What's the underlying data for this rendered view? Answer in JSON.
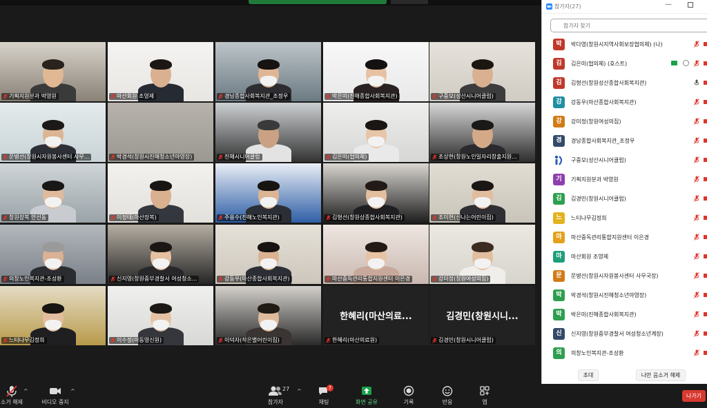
{
  "colors": {
    "accent_green": "#1aa14c",
    "mic_off_red": "#e0352b",
    "active_speaker_border": "#d8c640",
    "leave_red": "#d83a2f"
  },
  "tiles": [
    {
      "name": "기획지원분과 박영원",
      "bg": "#8a8277",
      "wall": "#d7d2ca",
      "skin": "#e0b894",
      "hair": "#2a221c",
      "shirt": "#3a3a3a",
      "mask": false
    },
    {
      "name": "마산회원 조영제",
      "bg": "#e8e6e3",
      "wall": "#f4f3f1",
      "skin": "#d9b090",
      "hair": "#1c1714",
      "shirt": "#262a33",
      "mask": false
    },
    {
      "name": "경남종합사회복지관_조정우",
      "bg": "#6c7a82",
      "wall": "#bdc5c9",
      "skin": "#dfb695",
      "hair": "#161310",
      "shirt": "#2d2d31",
      "mask": true
    },
    {
      "name": "박은미(진해종합사회복지관)",
      "bg": "#e9e9ea",
      "wall": "#f8f8f8",
      "skin": "#e6c1a3",
      "hair": "#141111",
      "shirt": "#2a2222",
      "mask": true
    },
    {
      "name": "구중모(성산시니어클럽)",
      "bg": "#d0ccc4",
      "wall": "#e6e2db",
      "skin": "#d9b090",
      "hair": "#1c1612",
      "shirt": "#3d3c3c",
      "mask": false
    },
    {
      "name": "문병선(창원시자원봉사센터 사무...",
      "bg": "#c8d3d6",
      "wall": "#e5ebec",
      "skin": "#dcb594",
      "hair": "#1c1a18",
      "shirt": "#2c2f36",
      "mask": true
    },
    {
      "name": "박경석(창원시진해청소년야영장)",
      "bg": "#9b9892",
      "wall": "#b7b3ac",
      "skin": "#000000",
      "hair": "#000000",
      "shirt": "#000000",
      "mask": false,
      "empty": true
    },
    {
      "name": "진해시니어클럽",
      "bg": "#333333",
      "wall": "#cdd0d2",
      "skin": "#caa283",
      "hair": "#3a3a3a",
      "shirt": "#e3e3e3",
      "mask": false
    },
    {
      "name": "김은미(협의체)",
      "bg": "#d6d6d4",
      "wall": "#eeeeec",
      "skin": "#e7c5a8",
      "hair": "#1a1614",
      "shirt": "#e9e9e9",
      "mask": true
    },
    {
      "name": "조상현(창원노인일자리창출지원...",
      "bg": "#2e2e2e",
      "wall": "#d7d7d7",
      "skin": "#d4a987",
      "hair": "#1b1917",
      "shirt": "#2a2a2e",
      "mask": false
    },
    {
      "name": "창원장복 안선동",
      "bg": "#9aa3a8",
      "wall": "#cfd5d8",
      "skin": "#e0bb9b",
      "hair": "#1a1816",
      "shirt": "#c8ccd0",
      "mask": true
    },
    {
      "name": "이정태(마산장복)",
      "bg": "#e3e1dc",
      "wall": "#f2f1ee",
      "skin": "#d9b090",
      "hair": "#191512",
      "shirt": "#34373e",
      "mask": false
    },
    {
      "name": "주용수(진해노인복지관)",
      "bg": "#2f5fa6",
      "wall": "#e9eef5",
      "skin": "#dcb594",
      "hair": "#171412",
      "shirt": "#2b2e35",
      "mask": true
    },
    {
      "name": "김형선(창원상종합사회복지관)",
      "bg": "#1e1e1e",
      "wall": "#d9d6d1",
      "skin": "#e3bf9f",
      "hair": "#221a16",
      "shirt": "#1f1f22",
      "mask": true
    },
    {
      "name": "조미현(신나는어린이집)",
      "bg": "#c9c4b9",
      "wall": "#e1ddd3",
      "skin": "#e2bd9d",
      "hair": "#1a1614",
      "shirt": "#2e2e33",
      "mask": true
    },
    {
      "name": "의창노인복지관-조성환",
      "bg": "#7a8088",
      "wall": "#b3b8bd",
      "skin": "#dbb293",
      "hair": "#9a9a9a",
      "shirt": "#2a2c30",
      "mask": true
    },
    {
      "name": "신지영(창원중부경찰서 여성청소...",
      "bg": "#262626",
      "wall": "#b6aea3",
      "skin": "#e4c0a0",
      "hair": "#1b1714",
      "shirt": "#27272a",
      "mask": true
    },
    {
      "name": "강동우(마산종합사회복지관)",
      "bg": "#ccc6bc",
      "wall": "#e6e1d8",
      "skin": "#dab291",
      "hair": "#161311",
      "shirt": "#2b2f35",
      "mask": true
    },
    {
      "name": "마산중독관리통합지원센터 이은경",
      "bg": "#c9b8b0",
      "wall": "#eee6e1",
      "skin": "#e6c3a5",
      "hair": "#241a15",
      "shirt": "#c7a89a",
      "mask": true
    },
    {
      "name": "강미정(창원여성의집)",
      "bg": "#d7d3cd",
      "wall": "#ebe7e1",
      "skin": "#e2be9e",
      "hair": "#3b2b20",
      "shirt": "#f0eeea",
      "mask": true
    },
    {
      "name": "느티나무김정희",
      "bg": "#b79a4a",
      "wall": "#e5dcc5",
      "skin": "#e3be9e",
      "hair": "#171412",
      "shirt": "#1f1f22",
      "mask": true
    },
    {
      "name": "이수정(마동영신원)",
      "bg": "#d8d8d6",
      "wall": "#efefed",
      "skin": "#e5c2a3",
      "hair": "#1c1815",
      "shirt": "#35373d",
      "mask": true
    },
    {
      "name": "이덕자(작은별어린이집)",
      "bg": "#2a2a2a",
      "wall": "#d4d1cc",
      "skin": "#e0bb9b",
      "hair": "#211b16",
      "shirt": "#3a3533",
      "mask": true
    },
    {
      "name": "한혜리(마산의료원)",
      "big": "한혜리(마산의료..."
    },
    {
      "name": "김경민(창원시니어클럽)",
      "big": "김경민(창원시니..."
    }
  ],
  "toolbar": {
    "mute_label": "소거 해제",
    "video_label": "비디오 중지",
    "participants_label": "참가자",
    "participants_count": "27",
    "chat_label": "채팅",
    "chat_badge": "7",
    "share_label": "화면 공유",
    "record_label": "기록",
    "reactions_label": "반응",
    "apps_label": "앱",
    "leave_label": "나가기"
  },
  "panel": {
    "title": "참가자(27)",
    "search_placeholder": "참가자 찾기",
    "invite_label": "초대",
    "mute_all_label": "나만 음소거 해제",
    "participants": [
      {
        "initial": "박",
        "name": "박다영(창원시지역사회보장협의체) (나)",
        "color": "#c0392b",
        "mic": "off"
      },
      {
        "initial": "김",
        "name": "김은미(협의체) (호스트)",
        "color": "#c0392b",
        "mic": "off",
        "share": true
      },
      {
        "initial": "김",
        "name": "김형선(창원성산종합사회복지관)",
        "color": "#c0392b",
        "mic": "on"
      },
      {
        "initial": "강",
        "name": "강동우(마산종합사회복지관)",
        "color": "#1f8fa4",
        "mic": "off"
      },
      {
        "initial": "강",
        "name": "강미정(창원여성의집)",
        "color": "#d27a18",
        "mic": "off"
      },
      {
        "initial": "경",
        "name": "경남종합사회복지관_조정우",
        "color": "#344a6b",
        "mic": "off"
      },
      {
        "initial": "img",
        "name": "구중모(성산시니어클럽)",
        "color": "#2d5bb8",
        "mic": "off"
      },
      {
        "initial": "기",
        "name": "기획지원분과 박영원",
        "color": "#8e3fae",
        "mic": "off"
      },
      {
        "initial": "김",
        "name": "김경민(창원시니어클럽)",
        "color": "#2e9f4f",
        "mic": "off"
      },
      {
        "initial": "느",
        "name": "느티나무김정희",
        "color": "#e3b21d",
        "mic": "off"
      },
      {
        "initial": "마",
        "name": "마산중독관리통합지원센터 이은경",
        "color": "#e3a11d",
        "mic": "off"
      },
      {
        "initial": "마",
        "name": "마산회원 조영제",
        "color": "#1e9e7a",
        "mic": "off"
      },
      {
        "initial": "문",
        "name": "문병선(창원시자원봉사센터 사무국장)",
        "color": "#d27a18",
        "mic": "off"
      },
      {
        "initial": "박",
        "name": "박경석(창원시진해청소년야영장)",
        "color": "#2e9f4f",
        "mic": "off"
      },
      {
        "initial": "박",
        "name": "박은미(진해종합사회복지관)",
        "color": "#2e9f4f",
        "mic": "off"
      },
      {
        "initial": "신",
        "name": "신지영(창원중부경찰서 여성청소년계장)",
        "color": "#344a6b",
        "mic": "off"
      },
      {
        "initial": "의",
        "name": "의창노인복지관-조성환",
        "color": "#2e9f4f",
        "mic": "off"
      }
    ]
  }
}
